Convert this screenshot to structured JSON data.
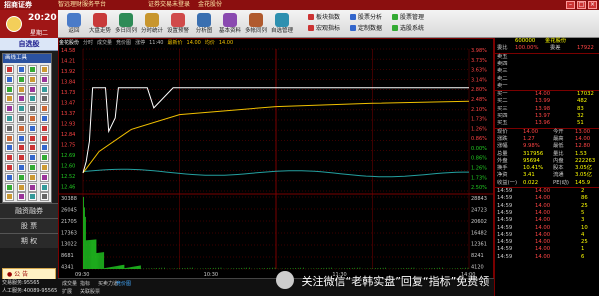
{
  "titlebar": {
    "brand": "招商证券",
    "text1": "智远理财服务平台",
    "text2": "证券交易未登录",
    "text3": "金花股份"
  },
  "clock": {
    "time": "20:20",
    "weekday": "星期二"
  },
  "toolbar": {
    "buttons": [
      {
        "label": "返回",
        "icon": "back-icon",
        "color": "#4a7bc8"
      },
      {
        "label": "大盘走势",
        "icon": "market-icon",
        "color": "#c83a3a"
      },
      {
        "label": "多日同列",
        "icon": "multiday-icon",
        "color": "#2e8b57"
      },
      {
        "label": "分时统计",
        "icon": "stats-icon",
        "color": "#c8962e"
      },
      {
        "label": "设置预警",
        "icon": "alarm-icon",
        "color": "#d04a4a"
      },
      {
        "label": "分析图",
        "icon": "analysis-icon",
        "color": "#3a6fb0"
      },
      {
        "label": "基本资料",
        "icon": "info-icon",
        "color": "#8a4ab0"
      },
      {
        "label": "多帐同列",
        "icon": "accounts-icon",
        "color": "#b05a2e"
      },
      {
        "label": "自选管理",
        "icon": "favorites-icon",
        "color": "#2e90b0"
      }
    ],
    "links": [
      "板块指数",
      "宏观指标",
      "股票分析",
      "定制数据",
      "股票管理",
      "选股系统"
    ]
  },
  "sidebar": {
    "header": "自选股",
    "tools_title": "画线工具",
    "tool_colors": [
      "#c33",
      "#36c",
      "#3a3",
      "#c93",
      "#939",
      "#399",
      "#666",
      "#c63",
      "#36c",
      "#c33"
    ],
    "buttons": [
      "融资融券",
      "股 票",
      "期 权"
    ],
    "notice": "公 告",
    "status_line1": "交易服务:95565",
    "status_line2": "人工服务:40089-95565"
  },
  "chart": {
    "header": [
      "金花股份",
      "分时",
      "成交量",
      "竞价图",
      "涨停",
      "11:40",
      "最新价",
      "14.00",
      "均价",
      "14.00"
    ],
    "y_left": [
      "14.58",
      "14.21",
      "13.92",
      "13.84",
      "13.73",
      "13.47",
      "13.37",
      "12.93",
      "12.84",
      "12.75",
      "12.69",
      "12.60",
      "12.52",
      "12.46"
    ],
    "y_right": [
      "3.98%",
      "3.73%",
      "3.63%",
      "3.14%",
      "2.80%",
      "2.48%",
      "2.10%",
      "1.73%",
      "1.26%",
      "0.86%",
      "0.00%",
      "0.86%",
      "1.26%",
      "1.73%",
      "2.50%"
    ],
    "vol_labels_left": [
      "30388",
      "26045",
      "21705",
      "17363",
      "13022",
      "8681",
      "4341"
    ],
    "vol_labels_right": [
      "28843",
      "24723",
      "20602",
      "16482",
      "12361",
      "8241",
      "4120"
    ],
    "x_labels": [
      "09:30",
      "10:30",
      "11:30",
      "14:00"
    ],
    "tabs": [
      "成交量",
      "指标",
      "买卖力道",
      "竞价图"
    ],
    "subtabs": [
      "扩展",
      "关联股票"
    ],
    "price_line": [
      {
        "t": 0,
        "p": 12.73
      },
      {
        "t": 2,
        "p": 12.9
      },
      {
        "t": 4,
        "p": 13.2
      },
      {
        "t": 6,
        "p": 14.0
      },
      {
        "t": 14,
        "p": 14.0
      },
      {
        "t": 16,
        "p": 13.35
      },
      {
        "t": 20,
        "p": 13.55
      },
      {
        "t": 22,
        "p": 14.0
      },
      {
        "t": 40,
        "p": 14.0
      },
      {
        "t": 44,
        "p": 13.7
      },
      {
        "t": 56,
        "p": 14.0
      },
      {
        "t": 240,
        "p": 14.0
      }
    ],
    "avg_line": [
      {
        "t": 0,
        "p": 12.73
      },
      {
        "t": 10,
        "p": 13.05
      },
      {
        "t": 30,
        "p": 13.38
      },
      {
        "t": 60,
        "p": 13.6
      },
      {
        "t": 120,
        "p": 13.72
      },
      {
        "t": 180,
        "p": 13.77
      },
      {
        "t": 240,
        "p": 13.8
      }
    ],
    "price_range": [
      12.46,
      14.58
    ],
    "volume_max": 30388,
    "colors": {
      "price": "#ffffff",
      "avg": "#f0c000",
      "aux": "#24a0a0",
      "vol": "#22cc22",
      "grid": "#7a0000"
    }
  },
  "quote": {
    "code": "600000",
    "name": "金花股份",
    "wei_bi_label": "委比",
    "wei_bi": "100.00%",
    "wei_cha_label": "委差",
    "wei_cha": "17922",
    "sell": [
      {
        "label": "卖五",
        "price": "",
        "vol": ""
      },
      {
        "label": "卖四",
        "price": "",
        "vol": ""
      },
      {
        "label": "卖三",
        "price": "",
        "vol": ""
      },
      {
        "label": "卖二",
        "price": "",
        "vol": ""
      },
      {
        "label": "卖一",
        "price": "",
        "vol": ""
      }
    ],
    "buy": [
      {
        "label": "买一",
        "price": "14.00",
        "vol": "17032"
      },
      {
        "label": "买二",
        "price": "13.99",
        "vol": "482"
      },
      {
        "label": "买三",
        "price": "13.98",
        "vol": "83"
      },
      {
        "label": "买四",
        "price": "13.97",
        "vol": "32"
      },
      {
        "label": "买五",
        "price": "13.96",
        "vol": "51"
      }
    ],
    "stats": [
      {
        "l1": "现价",
        "v1": "14.00",
        "l2": "今开",
        "v2": "13.00"
      },
      {
        "l1": "涨跌",
        "v1": "1.27",
        "l2": "最高",
        "v2": "14.00"
      },
      {
        "l1": "涨幅",
        "v1": "9.98%",
        "l2": "最低",
        "v2": "12.80"
      },
      {
        "l1": "总量",
        "v1": "317956",
        "l2": "量比",
        "v2": "1.53"
      },
      {
        "l1": "外盘",
        "v1": "95694",
        "l2": "内盘",
        "v2": "222263"
      },
      {
        "l1": "换手",
        "v1": "10.41%",
        "l2": "股本",
        "v2": "3.05亿"
      },
      {
        "l1": "净资",
        "v1": "3.41",
        "l2": "流通",
        "v2": "3.05亿"
      },
      {
        "l1": "收益(一)",
        "v1": "0.022",
        "l2": "PE(动)",
        "v2": "145.9"
      }
    ],
    "ticks": [
      {
        "t": "14:59",
        "p": "14.00",
        "v": "2"
      },
      {
        "t": "14:59",
        "p": "14.00",
        "v": "86"
      },
      {
        "t": "14:59",
        "p": "14.00",
        "v": "25"
      },
      {
        "t": "14:59",
        "p": "14.00",
        "v": "5"
      },
      {
        "t": "14:59",
        "p": "14.00",
        "v": "3"
      },
      {
        "t": "14:59",
        "p": "14.00",
        "v": "10"
      },
      {
        "t": "14:59",
        "p": "14.00",
        "v": "4"
      },
      {
        "t": "14:59",
        "p": "14.00",
        "v": "25"
      },
      {
        "t": "14:59",
        "p": "14.00",
        "v": "1"
      },
      {
        "t": "14:59",
        "p": "14.00",
        "v": "6"
      }
    ],
    "tabs": [
      "笔",
      "价",
      "细",
      "势",
      "联",
      "值",
      "主",
      "筹"
    ]
  },
  "watermark": {
    "text": "关注微信“老韩实盘”回复“指标”免费领"
  }
}
